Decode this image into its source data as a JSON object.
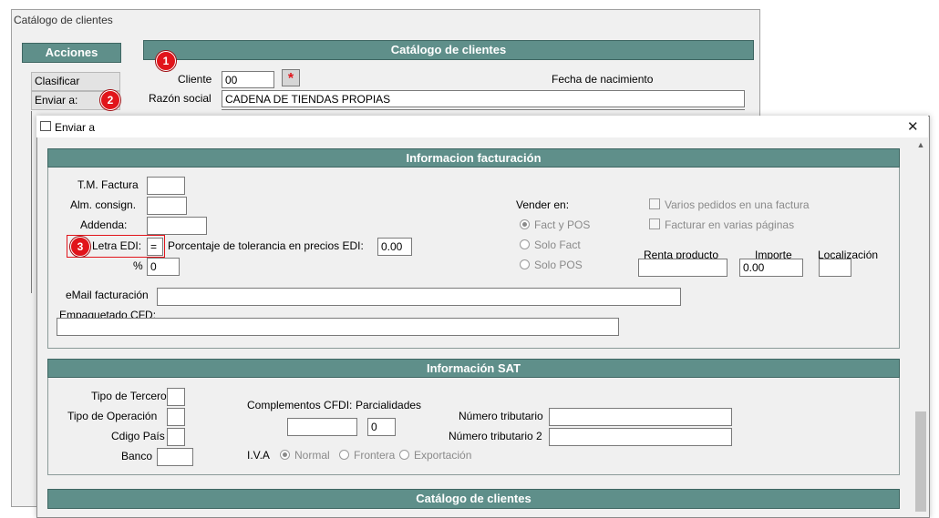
{
  "window": {
    "title": "Catálogo de clientes"
  },
  "acciones": {
    "title": "Acciones",
    "clasificar": "Clasificar",
    "enviar": "Enviar a:"
  },
  "header": {
    "title": "Catálogo de clientes"
  },
  "cliente": {
    "label": "Cliente",
    "value": "00",
    "required_mark": "*"
  },
  "fecha_nacimiento": {
    "label": "Fecha de nacimiento"
  },
  "razon_social": {
    "label": "Razón social",
    "value": "CADENA DE TIENDAS PROPIAS"
  },
  "badges": {
    "one": "1",
    "two": "2",
    "three": "3"
  },
  "dialog": {
    "title": "Enviar a",
    "close": "✕",
    "facturacion": {
      "title": "Informacion facturación",
      "tm_factura": {
        "label": "T.M. Factura",
        "value": ""
      },
      "alm_consign": {
        "label": "Alm. consign.",
        "value": ""
      },
      "addenda": {
        "label": "Addenda:",
        "value": ""
      },
      "letra_edi": {
        "label": "Letra EDI:",
        "value": "="
      },
      "porcentaje": {
        "label": "Porcentaje de tolerancia en precios EDI:",
        "value": "0.00"
      },
      "pct": {
        "label": "%",
        "value": "0"
      },
      "vender_en": {
        "label": "Vender en:",
        "options": [
          "Fact y POS",
          "Solo Fact",
          "Solo POS"
        ],
        "selected": "Fact y POS"
      },
      "varios_pedidos": "Varios pedidos en una factura",
      "varias_paginas": "Facturar en varias páginas",
      "renta_producto": {
        "label": "Renta producto",
        "value": ""
      },
      "importe": {
        "label": "Importe",
        "value": "0.00"
      },
      "localizacion": {
        "label": "Localización",
        "value": ""
      },
      "email": {
        "label": "eMail facturación",
        "value": ""
      },
      "empaquetado": {
        "label": "Empaquetado CFD:",
        "value": ""
      }
    },
    "sat": {
      "title": "Información SAT",
      "tipo_tercero": {
        "label": "Tipo de Tercero",
        "value": ""
      },
      "tipo_operacion": {
        "label": "Tipo de Operación",
        "value": ""
      },
      "codigo_pais": {
        "label": "Cdigo País",
        "value": ""
      },
      "banco": {
        "label": "Banco",
        "value": ""
      },
      "complementos": {
        "label": "Complementos CFDI:",
        "value": ""
      },
      "parcialidades": {
        "label": "Parcialidades",
        "value": "0"
      },
      "numero_tributario": {
        "label": "Número tributario",
        "value": ""
      },
      "numero_tributario_2": {
        "label": "Número tributario 2",
        "value": ""
      },
      "iva": {
        "label": "I.V.A",
        "options": [
          "Normal",
          "Frontera",
          "Exportación"
        ],
        "selected": "Normal"
      }
    },
    "catalogo_bar": {
      "title": "Catálogo de clientes"
    }
  },
  "colors": {
    "header_bar": "#5f8f8a",
    "badge": "#e1141b"
  }
}
